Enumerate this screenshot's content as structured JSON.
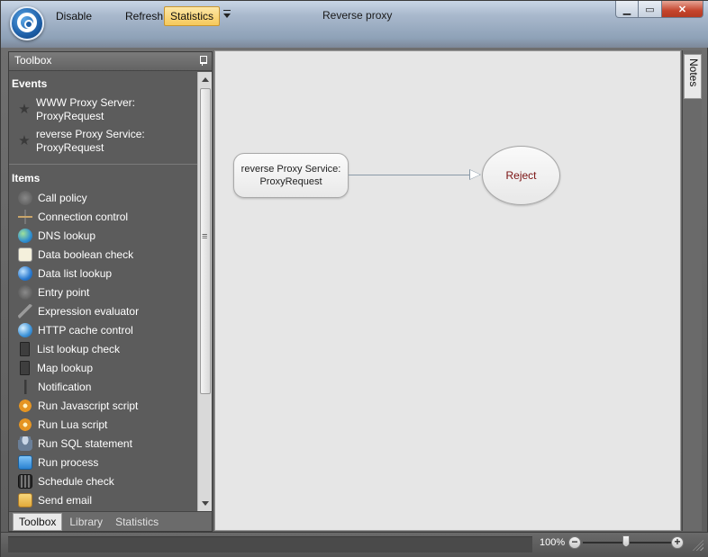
{
  "toolbar": {
    "disable_label": "Disable",
    "refresh_label": "Refresh",
    "statistics_label": "Statistics"
  },
  "window": {
    "title": "Reverse proxy"
  },
  "toolbox": {
    "title": "Toolbox",
    "events_title": "Events",
    "events": [
      {
        "line1": "WWW Proxy Server:",
        "line2": "ProxyRequest"
      },
      {
        "line1": "reverse Proxy Service:",
        "line2": "ProxyRequest"
      }
    ],
    "items_title": "Items",
    "items": [
      {
        "label": "Call policy",
        "icon": "call-policy-icon"
      },
      {
        "label": "Connection control",
        "icon": "connection-control-icon"
      },
      {
        "label": "DNS lookup",
        "icon": "dns-lookup-icon"
      },
      {
        "label": "Data boolean check",
        "icon": "data-boolean-check-icon"
      },
      {
        "label": "Data list lookup",
        "icon": "data-list-lookup-icon"
      },
      {
        "label": "Entry point",
        "icon": "entry-point-icon"
      },
      {
        "label": "Expression evaluator",
        "icon": "expression-evaluator-icon"
      },
      {
        "label": "HTTP cache control",
        "icon": "http-cache-control-icon"
      },
      {
        "label": "List lookup check",
        "icon": "list-lookup-check-icon"
      },
      {
        "label": "Map lookup",
        "icon": "map-lookup-icon"
      },
      {
        "label": "Notification",
        "icon": "notification-icon"
      },
      {
        "label": "Run Javascript script",
        "icon": "run-javascript-icon"
      },
      {
        "label": "Run Lua script",
        "icon": "run-lua-icon"
      },
      {
        "label": "Run SQL statement",
        "icon": "run-sql-icon"
      },
      {
        "label": "Run process",
        "icon": "run-process-icon"
      },
      {
        "label": "Schedule check",
        "icon": "schedule-check-icon"
      },
      {
        "label": "Send email",
        "icon": "send-email-icon"
      }
    ],
    "tabs": [
      "Toolbox",
      "Library",
      "Statistics"
    ]
  },
  "canvas": {
    "event_node_line1": "reverse Proxy Service:",
    "event_node_line2": "ProxyRequest",
    "reject_node": "Reject"
  },
  "notes": {
    "label": "Notes"
  },
  "status": {
    "zoom": "100%",
    "zoom_minus": "−",
    "zoom_plus": "+"
  }
}
